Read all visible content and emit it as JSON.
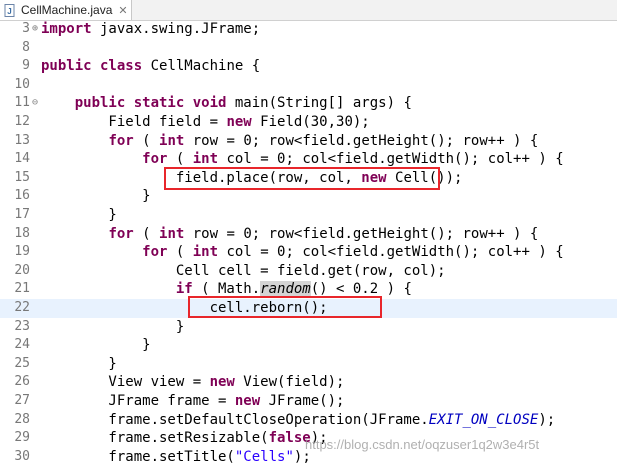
{
  "tab": {
    "title": "CellMachine.java",
    "icon": "java-file-icon"
  },
  "lines": [
    {
      "n": "3",
      "fold": "+",
      "tokens": [
        {
          "t": "kw",
          "v": "import"
        },
        {
          "t": "",
          "v": " javax.swing.JFrame;"
        }
      ]
    },
    {
      "n": "8",
      "tokens": []
    },
    {
      "n": "9",
      "tokens": [
        {
          "t": "kw",
          "v": "public class"
        },
        {
          "t": "",
          "v": " CellMachine {"
        }
      ]
    },
    {
      "n": "10",
      "tokens": []
    },
    {
      "n": "11",
      "fold": "−",
      "tokens": [
        {
          "t": "",
          "v": "    "
        },
        {
          "t": "kw",
          "v": "public static void"
        },
        {
          "t": "",
          "v": " main(String[] args) {"
        }
      ]
    },
    {
      "n": "12",
      "tokens": [
        {
          "t": "",
          "v": "        Field field = "
        },
        {
          "t": "kw",
          "v": "new"
        },
        {
          "t": "",
          "v": " Field(30,30);"
        }
      ]
    },
    {
      "n": "13",
      "tokens": [
        {
          "t": "",
          "v": "        "
        },
        {
          "t": "kw",
          "v": "for"
        },
        {
          "t": "",
          "v": " ( "
        },
        {
          "t": "kw",
          "v": "int"
        },
        {
          "t": "",
          "v": " row = 0; row<field.getHeight(); row++ ) {"
        }
      ]
    },
    {
      "n": "14",
      "tokens": [
        {
          "t": "",
          "v": "            "
        },
        {
          "t": "kw",
          "v": "for"
        },
        {
          "t": "",
          "v": " ( "
        },
        {
          "t": "kw",
          "v": "int"
        },
        {
          "t": "",
          "v": " col = 0; col<field.getWidth(); col++ ) {"
        }
      ]
    },
    {
      "n": "15",
      "tokens": [
        {
          "t": "",
          "v": "                field.place(row, col, "
        },
        {
          "t": "kw",
          "v": "new"
        },
        {
          "t": "",
          "v": " Cell());"
        }
      ]
    },
    {
      "n": "16",
      "tokens": [
        {
          "t": "",
          "v": "            }"
        }
      ]
    },
    {
      "n": "17",
      "tokens": [
        {
          "t": "",
          "v": "        }"
        }
      ]
    },
    {
      "n": "18",
      "tokens": [
        {
          "t": "",
          "v": "        "
        },
        {
          "t": "kw",
          "v": "for"
        },
        {
          "t": "",
          "v": " ( "
        },
        {
          "t": "kw",
          "v": "int"
        },
        {
          "t": "",
          "v": " row = 0; row<field.getHeight(); row++ ) {"
        }
      ]
    },
    {
      "n": "19",
      "tokens": [
        {
          "t": "",
          "v": "            "
        },
        {
          "t": "kw",
          "v": "for"
        },
        {
          "t": "",
          "v": " ( "
        },
        {
          "t": "kw",
          "v": "int"
        },
        {
          "t": "",
          "v": " col = 0; col<field.getWidth(); col++ ) {"
        }
      ]
    },
    {
      "n": "20",
      "tokens": [
        {
          "t": "",
          "v": "                Cell cell = field.get(row, col);"
        }
      ]
    },
    {
      "n": "21",
      "tokens": [
        {
          "t": "",
          "v": "                "
        },
        {
          "t": "kw",
          "v": "if"
        },
        {
          "t": "",
          "v": " ( Math."
        },
        {
          "t": "stat occurrence",
          "v": "random"
        },
        {
          "t": "",
          "v": "() < 0.2 ) {"
        }
      ]
    },
    {
      "n": "22",
      "current": true,
      "tokens": [
        {
          "t": "",
          "v": "                    cell.reborn();"
        }
      ]
    },
    {
      "n": "23",
      "tokens": [
        {
          "t": "",
          "v": "                }"
        }
      ]
    },
    {
      "n": "24",
      "tokens": [
        {
          "t": "",
          "v": "            }"
        }
      ]
    },
    {
      "n": "25",
      "tokens": [
        {
          "t": "",
          "v": "        }"
        }
      ]
    },
    {
      "n": "26",
      "tokens": [
        {
          "t": "",
          "v": "        View view = "
        },
        {
          "t": "kw",
          "v": "new"
        },
        {
          "t": "",
          "v": " View(field);"
        }
      ]
    },
    {
      "n": "27",
      "tokens": [
        {
          "t": "",
          "v": "        JFrame frame = "
        },
        {
          "t": "kw",
          "v": "new"
        },
        {
          "t": "",
          "v": " JFrame();"
        }
      ]
    },
    {
      "n": "28",
      "tokens": [
        {
          "t": "",
          "v": "        frame.setDefaultCloseOperation(JFrame."
        },
        {
          "t": "fieldc",
          "v": "EXIT_ON_CLOSE"
        },
        {
          "t": "",
          "v": ");"
        }
      ]
    },
    {
      "n": "29",
      "tokens": [
        {
          "t": "",
          "v": "        frame.setResizable("
        },
        {
          "t": "kw",
          "v": "false"
        },
        {
          "t": "",
          "v": ");"
        }
      ]
    },
    {
      "n": "30",
      "tokens": [
        {
          "t": "",
          "v": "        frame.setTitle("
        },
        {
          "t": "str",
          "v": "\"Cells\""
        },
        {
          "t": "",
          "v": ");"
        }
      ]
    }
  ],
  "highlights": [
    {
      "name": "highlight-box-place"
    },
    {
      "name": "highlight-box-reborn"
    }
  ],
  "watermark": "https://blog.csdn.net/oqzuser1q2w3e4r5t",
  "colors": {
    "keyword": "#7f0055",
    "string": "#2a00ff",
    "constant": "#0000c0",
    "highlight": "#e8262b",
    "current_line": "#e8f2fe"
  }
}
